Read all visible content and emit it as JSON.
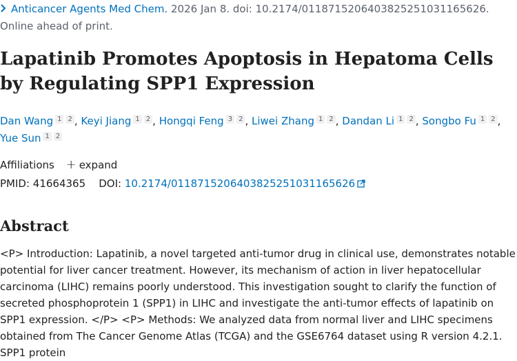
{
  "citation": {
    "journal": "Anticancer Agents Med Chem.",
    "details": "2026 Jan 8. doi: 10.2174/0118715206403825251031165626.",
    "status": "Online ahead of print."
  },
  "title": "Lapatinib Promotes Apoptosis in Hepatoma Cells by Regulating SPP1 Expression",
  "authors": [
    {
      "name": "Dan Wang",
      "aff": [
        "1",
        "2"
      ]
    },
    {
      "name": "Keyi Jiang",
      "aff": [
        "1",
        "2"
      ]
    },
    {
      "name": "Hongqi Feng",
      "aff": [
        "3",
        "2"
      ]
    },
    {
      "name": "Liwei Zhang",
      "aff": [
        "1",
        "2"
      ]
    },
    {
      "name": "Dandan Li",
      "aff": [
        "1",
        "2"
      ]
    },
    {
      "name": "Songbo Fu",
      "aff": [
        "1",
        "2"
      ]
    },
    {
      "name": "Yue Sun",
      "aff": [
        "1",
        "2"
      ]
    }
  ],
  "affiliations": {
    "label": "Affiliations",
    "expand_label": "expand"
  },
  "ids": {
    "pmid_label": "PMID:",
    "pmid": "41664365",
    "doi_label": "DOI:",
    "doi": "10.2174/0118715206403825251031165626"
  },
  "abstract": {
    "heading": "Abstract",
    "text": "<P> Introduction: Lapatinib, a novel targeted anti-tumor drug in clinical use, demonstrates notable potential for liver cancer treatment. However, its mechanism of action in liver hepatocellular carcinoma (LIHC) remains poorly understood. This investigation sought to clarify the function of secreted phosphoprotein 1 (SPP1) in LIHC and investigate the anti-tumor effects of lapatinib on SPP1 expression. </P> <P> Methods: We analyzed data from normal liver and LIHC specimens obtained from The Cancer Genome Atlas (TCGA) and the GSE6764 dataset using R version 4.2.1. SPP1 protein"
  },
  "icons": {
    "chevron": "chevron-right-icon",
    "expand": "plus-icon",
    "external": "external-link-icon"
  },
  "colors": {
    "link": "#0071bc",
    "text": "#212121",
    "muted": "#5b616b"
  }
}
